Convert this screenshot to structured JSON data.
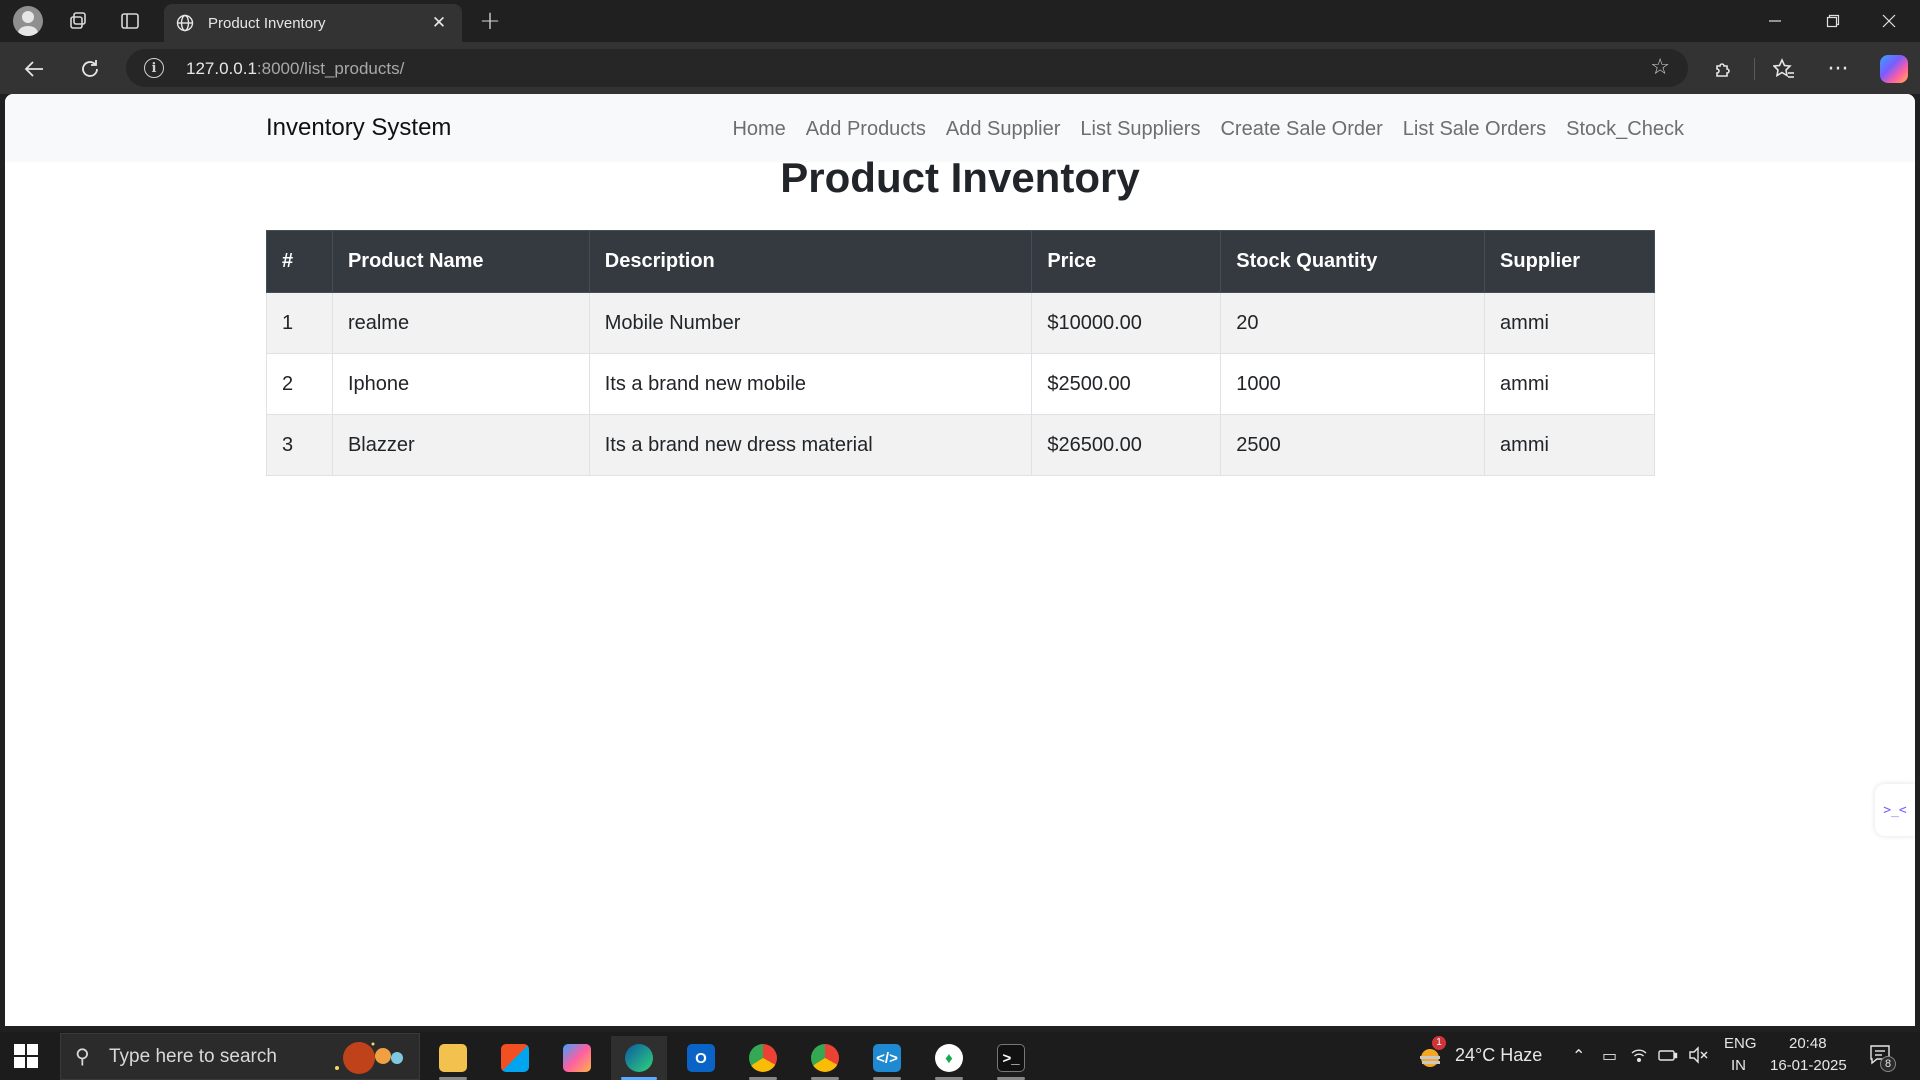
{
  "browser": {
    "tab_title": "Product Inventory",
    "url_host": "127.0.0.1",
    "url_rest": ":8000/list_products/"
  },
  "site": {
    "brand": "Inventory System",
    "nav": [
      "Home",
      "Add Products",
      "Add Supplier",
      "List Suppliers",
      "Create Sale Order",
      "List Sale Orders",
      "Stock_Check"
    ]
  },
  "page": {
    "title": "Product Inventory"
  },
  "table": {
    "headers": [
      "#",
      "Product Name",
      "Description",
      "Price",
      "Stock Quantity",
      "Supplier"
    ],
    "rows": [
      [
        "1",
        "realme",
        "Mobile Number",
        "$10000.00",
        "20",
        "ammi"
      ],
      [
        "2",
        "Iphone",
        "Its a brand new mobile",
        "$2500.00",
        "1000",
        "ammi"
      ],
      [
        "3",
        "Blazzer",
        "Its a brand new dress material",
        "$26500.00",
        "2500",
        "ammi"
      ]
    ]
  },
  "taskbar": {
    "search_placeholder": "Type here to search",
    "weather": "24°C  Haze",
    "weather_badge": "1",
    "lang_top": "ENG",
    "lang_bottom": "IN",
    "time": "20:48",
    "date": "16-01-2025",
    "notification_count": "8",
    "apps": [
      "file-explorer",
      "microsoft-store",
      "copilot",
      "edge",
      "outlook",
      "chrome-profile",
      "chrome",
      "vscode",
      "mongodb-compass",
      "terminal"
    ]
  },
  "colors": {
    "table_header_bg": "#343a40",
    "row_stripe": "#f2f2f2",
    "navbar_bg": "#f8f9fa",
    "active_accent": "#5fa8ff"
  }
}
